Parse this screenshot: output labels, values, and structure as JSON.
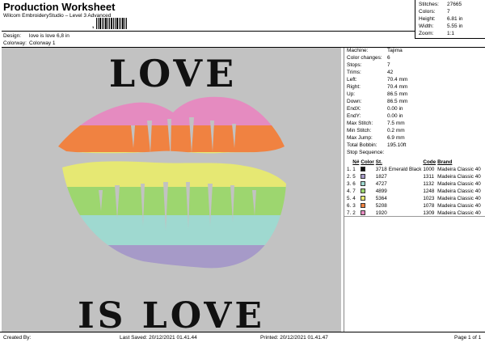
{
  "header": {
    "title": "Production Worksheet",
    "subtitle": "Wilcom EmbroideryStudio – Level 3 Advanced",
    "design_label": "Design:",
    "design_value": "love is love 6,8 in",
    "colorway_label": "Colorway:",
    "colorway_value": "Colorway 1"
  },
  "summary": [
    {
      "label": "Stitches:",
      "value": "27665"
    },
    {
      "label": "Colors:",
      "value": "7"
    },
    {
      "label": "Height:",
      "value": "6.81 in"
    },
    {
      "label": "Width:",
      "value": "5.55 in"
    },
    {
      "label": "Zoom:",
      "value": "1:1"
    }
  ],
  "design": {
    "text_top": "LOVE",
    "text_bottom": "IS LOVE",
    "stripe_colors": [
      "#e58bc0",
      "#f08241",
      "#e6e873",
      "#9dd66f",
      "#9fd9d0",
      "#a69ac8"
    ]
  },
  "properties": [
    {
      "label": "Machine:",
      "value": "Tajima"
    },
    {
      "label": "Color changes:",
      "value": "6"
    },
    {
      "label": "Stops:",
      "value": "7"
    },
    {
      "label": "Trims:",
      "value": "42"
    },
    {
      "label": "Left:",
      "value": "70.4 mm"
    },
    {
      "label": "Right:",
      "value": "70.4 mm"
    },
    {
      "label": "Up:",
      "value": "86.5 mm"
    },
    {
      "label": "Down:",
      "value": "86.5 mm"
    },
    {
      "label": "EndX:",
      "value": "0.00 in"
    },
    {
      "label": "EndY:",
      "value": "0.00 in"
    },
    {
      "label": "Max Stitch:",
      "value": "7.5 mm"
    },
    {
      "label": "Min Stitch:",
      "value": "0.2 mm"
    },
    {
      "label": "Max Jump:",
      "value": "6.9 mm"
    },
    {
      "label": "Total Bobbin:",
      "value": "195.10ft"
    }
  ],
  "stop_sequence": {
    "title": "Stop Sequence:",
    "headers": {
      "n": "N#",
      "color": "Color",
      "st": "St.",
      "code": "Code",
      "brand": "Brand"
    },
    "rows": [
      {
        "stop": "1.",
        "n": "1",
        "color": "#111111",
        "st": "3718",
        "name": "Emerald Black",
        "code": "1000",
        "brand": "Madeira Classic 40"
      },
      {
        "stop": "2.",
        "n": "5",
        "color": "#a69ac8",
        "st": "1827",
        "name": "",
        "code": "1311",
        "brand": "Madeira Classic 40"
      },
      {
        "stop": "3.",
        "n": "6",
        "color": "#9fd9d0",
        "st": "4727",
        "name": "",
        "code": "1132",
        "brand": "Madeira Classic 40"
      },
      {
        "stop": "4.",
        "n": "7",
        "color": "#9dd66f",
        "st": "4899",
        "name": "",
        "code": "1248",
        "brand": "Madeira Classic 40"
      },
      {
        "stop": "5.",
        "n": "4",
        "color": "#e6e873",
        "st": "5364",
        "name": "",
        "code": "1023",
        "brand": "Madeira Classic 40"
      },
      {
        "stop": "6.",
        "n": "3",
        "color": "#f08241",
        "st": "5208",
        "name": "",
        "code": "1078",
        "brand": "Madeira Classic 40"
      },
      {
        "stop": "7.",
        "n": "2",
        "color": "#e58bc0",
        "st": "1920",
        "name": "",
        "code": "1309",
        "brand": "Madeira Classic 40"
      }
    ]
  },
  "footer": {
    "created_by": "Created By:",
    "last_saved": "Last Saved: 20/12/2021 01.41.44",
    "printed": "Printed: 20/12/2021 01.41.47",
    "page": "Page 1 of 1"
  }
}
